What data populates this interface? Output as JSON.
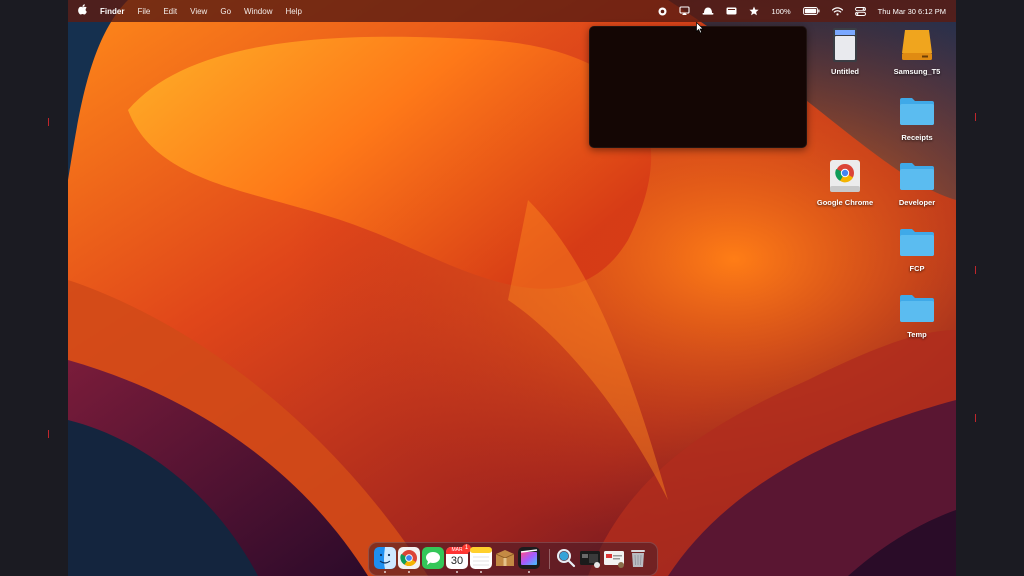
{
  "menubar": {
    "app_name": "Finder",
    "menus": [
      "File",
      "Edit",
      "View",
      "Go",
      "Window",
      "Help"
    ],
    "battery_percent": "100%",
    "datetime": "Thu Mar 30  6:12 PM"
  },
  "desktop": {
    "icons": [
      {
        "label": "Untitled",
        "icon": "sd-card-icon"
      },
      {
        "label": "Samsung_T5",
        "icon": "external-drive-icon"
      },
      {
        "label": "Receipts",
        "icon": "folder-icon"
      },
      {
        "label": "Google Chrome",
        "icon": "chrome-installer-icon"
      },
      {
        "label": "Developer",
        "icon": "folder-icon"
      },
      {
        "label": "FCP",
        "icon": "folder-icon"
      },
      {
        "label": "Temp",
        "icon": "folder-icon"
      }
    ]
  },
  "dock": {
    "calendar_month": "MAR",
    "calendar_day": "30",
    "calendar_badge": "1",
    "apps": [
      "finder",
      "chrome",
      "messages",
      "calendar",
      "notes",
      "archive-utility",
      "final-cut-pro",
      "screen-saver",
      "preview-window",
      "preview-window-2",
      "trash"
    ]
  },
  "colors": {
    "folder_blue": "#5bbcf0",
    "menubar_bg": "#5c1c12",
    "accent_red": "#c0262c"
  }
}
